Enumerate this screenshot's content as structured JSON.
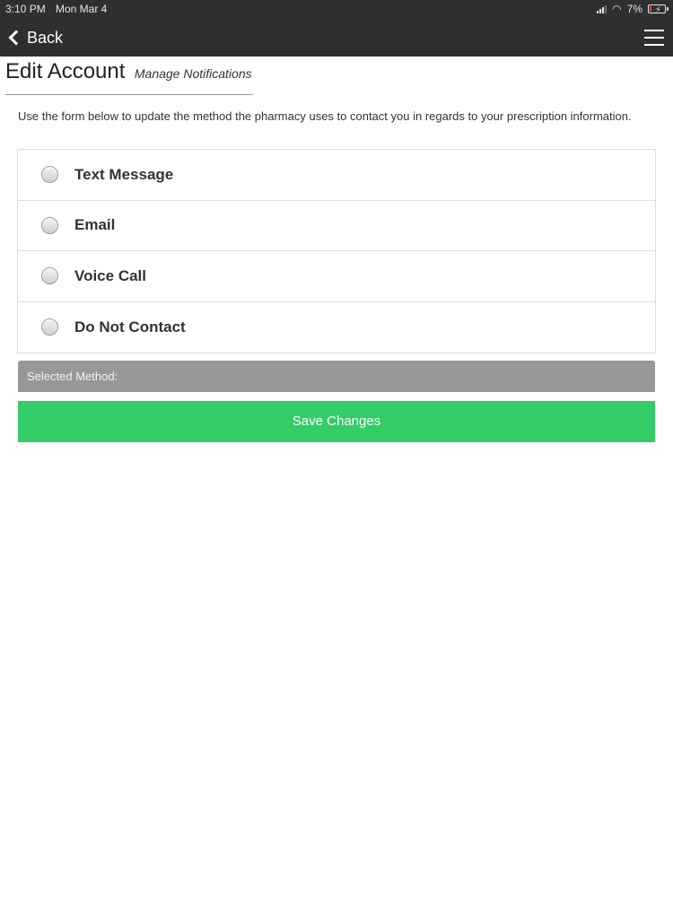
{
  "status_bar": {
    "time": "3:10 PM",
    "date": "Mon Mar 4",
    "battery": "7%"
  },
  "nav": {
    "back_label": "Back"
  },
  "header": {
    "title": "Edit Account",
    "subtitle": "Manage Notifications"
  },
  "intro_text": "Use the form below to update the method the pharmacy uses to contact you in regards to your prescription information.",
  "options": [
    {
      "label": "Text Message",
      "selected": false
    },
    {
      "label": "Email",
      "selected": false
    },
    {
      "label": "Voice Call",
      "selected": false
    },
    {
      "label": "Do Not Contact",
      "selected": false
    }
  ],
  "selected_method_label": "Selected Method:",
  "save_button_label": "Save Changes",
  "colors": {
    "nav_bg": "#2f2f31",
    "save_button": "#33cc66",
    "selected_bar": "#97979a"
  },
  "icons": {
    "back": "chevron-left-icon",
    "menu": "hamburger-menu-icon",
    "signal": "cellular-signal-icon",
    "wifi": "wifi-icon",
    "battery": "battery-icon"
  }
}
